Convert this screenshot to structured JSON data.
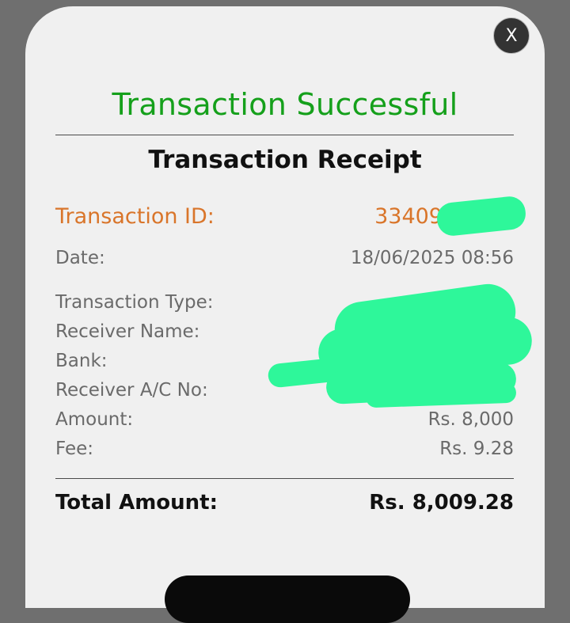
{
  "modal": {
    "close_label": "X",
    "status_title": "Transaction Successful",
    "receipt_title": "Transaction Receipt",
    "accent_color": "#15a01b",
    "highlight_color": "#d9752a"
  },
  "receipt": {
    "transaction_id_label": "Transaction ID:",
    "transaction_id_value": "33409",
    "date_label": "Date:",
    "date_value": "18/06/2025 08:56",
    "transaction_type_label": "Transaction Type:",
    "receiver_name_label": "Receiver Name:",
    "bank_label": "Bank:",
    "receiver_account_label": "Receiver A/C No:",
    "amount_label": "Amount:",
    "amount_value": "Rs. 8,000",
    "fee_label": "Fee:",
    "fee_value": "Rs. 9.28",
    "total_label": "Total Amount:",
    "total_value": "Rs. 8,009.28"
  },
  "redaction_color": "#2ef79a"
}
